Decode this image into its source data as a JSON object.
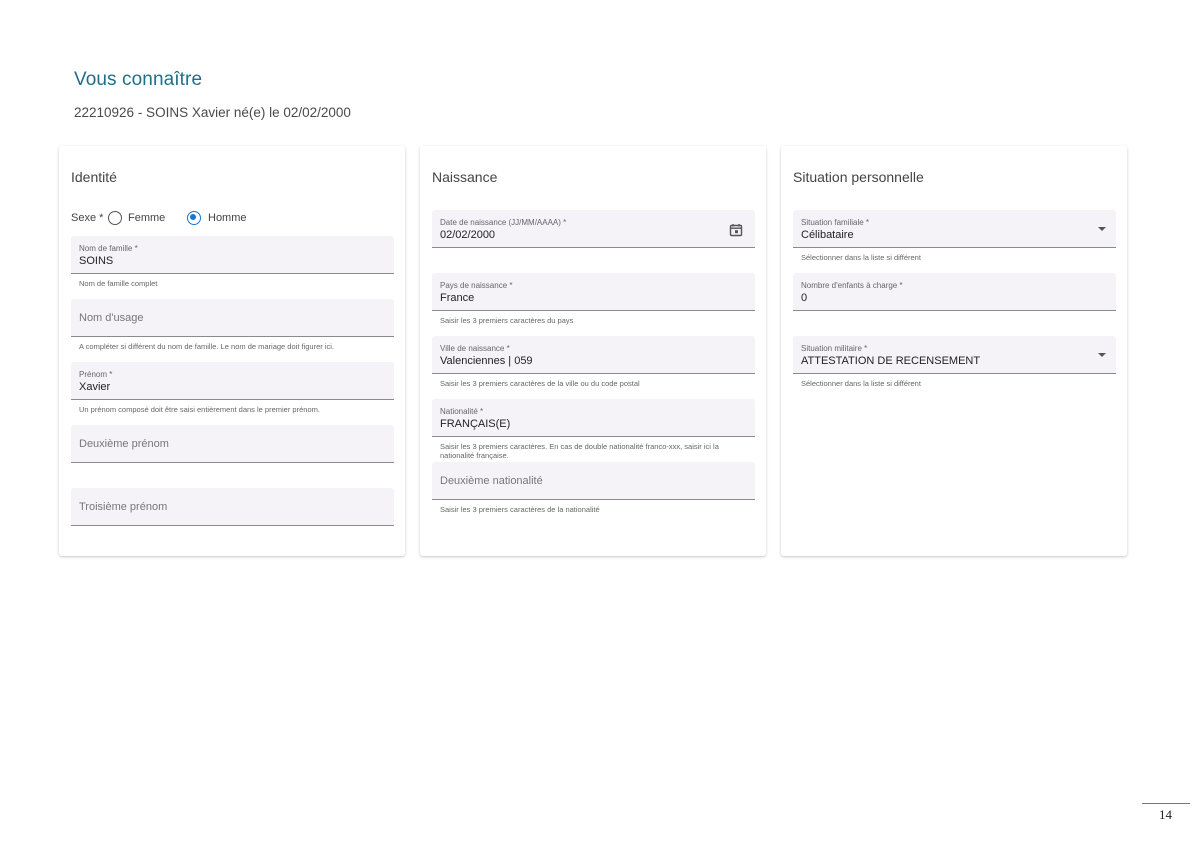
{
  "header": {
    "title": "Vous connaître",
    "subtitle": "22210926 - SOINS Xavier né(e) le 02/02/2000"
  },
  "identite": {
    "title": "Identité",
    "sexe": {
      "label": "Sexe *",
      "options": [
        "Femme",
        "Homme"
      ],
      "selected": "Homme"
    },
    "nom_famille": {
      "label": "Nom de famille *",
      "value": "SOINS",
      "hint": "Nom de famille complet"
    },
    "nom_usage": {
      "placeholder": "Nom d'usage",
      "hint": "A compléter si différent du nom de famille. Le nom de mariage doit figurer ici."
    },
    "prenom": {
      "label": "Prénom *",
      "value": "Xavier",
      "hint": "Un prénom composé doit être saisi entièrement dans le premier prénom."
    },
    "deuxieme_prenom": {
      "placeholder": "Deuxième prénom"
    },
    "troisieme_prenom": {
      "placeholder": "Troisième prénom"
    }
  },
  "naissance": {
    "title": "Naissance",
    "date": {
      "label": "Date de naissance (JJ/MM/AAAA) *",
      "value": "02/02/2000",
      "icon": "calendar-icon"
    },
    "pays": {
      "label": "Pays de naissance *",
      "value": "France",
      "hint": "Saisir les 3 premiers caractères du pays"
    },
    "ville": {
      "label": "Ville de naissance *",
      "value": "Valenciennes | 059",
      "hint": "Saisir les 3 premiers caractères de la ville ou du code postal"
    },
    "nationalite": {
      "label": "Nationalité *",
      "value": "FRANÇAIS(E)",
      "hint": "Saisir les 3 premiers caractères. En cas de double nationalité franco-xxx, saisir ici la nationalité française."
    },
    "deuxieme_nationalite": {
      "placeholder": "Deuxième nationalité",
      "hint": "Saisir les 3 premiers caractères de la nationalité"
    }
  },
  "situation": {
    "title": "Situation personnelle",
    "familiale": {
      "label": "Situation familiale *",
      "value": "Célibataire",
      "hint": "Sélectionner dans la liste si différent",
      "icon": "dropdown-caret-icon"
    },
    "enfants": {
      "label": "Nombre d'enfants à charge *",
      "value": "0"
    },
    "militaire": {
      "label": "Situation militaire *",
      "value": "ATTESTATION DE RECENSEMENT",
      "hint": "Sélectionner dans la liste si différent",
      "icon": "dropdown-caret-icon"
    }
  },
  "footer": {
    "page_number": "14"
  },
  "colors": {
    "title": "#1f6f8b",
    "radio_checked": "#1976d2",
    "field_bg": "#f5f2f8"
  }
}
